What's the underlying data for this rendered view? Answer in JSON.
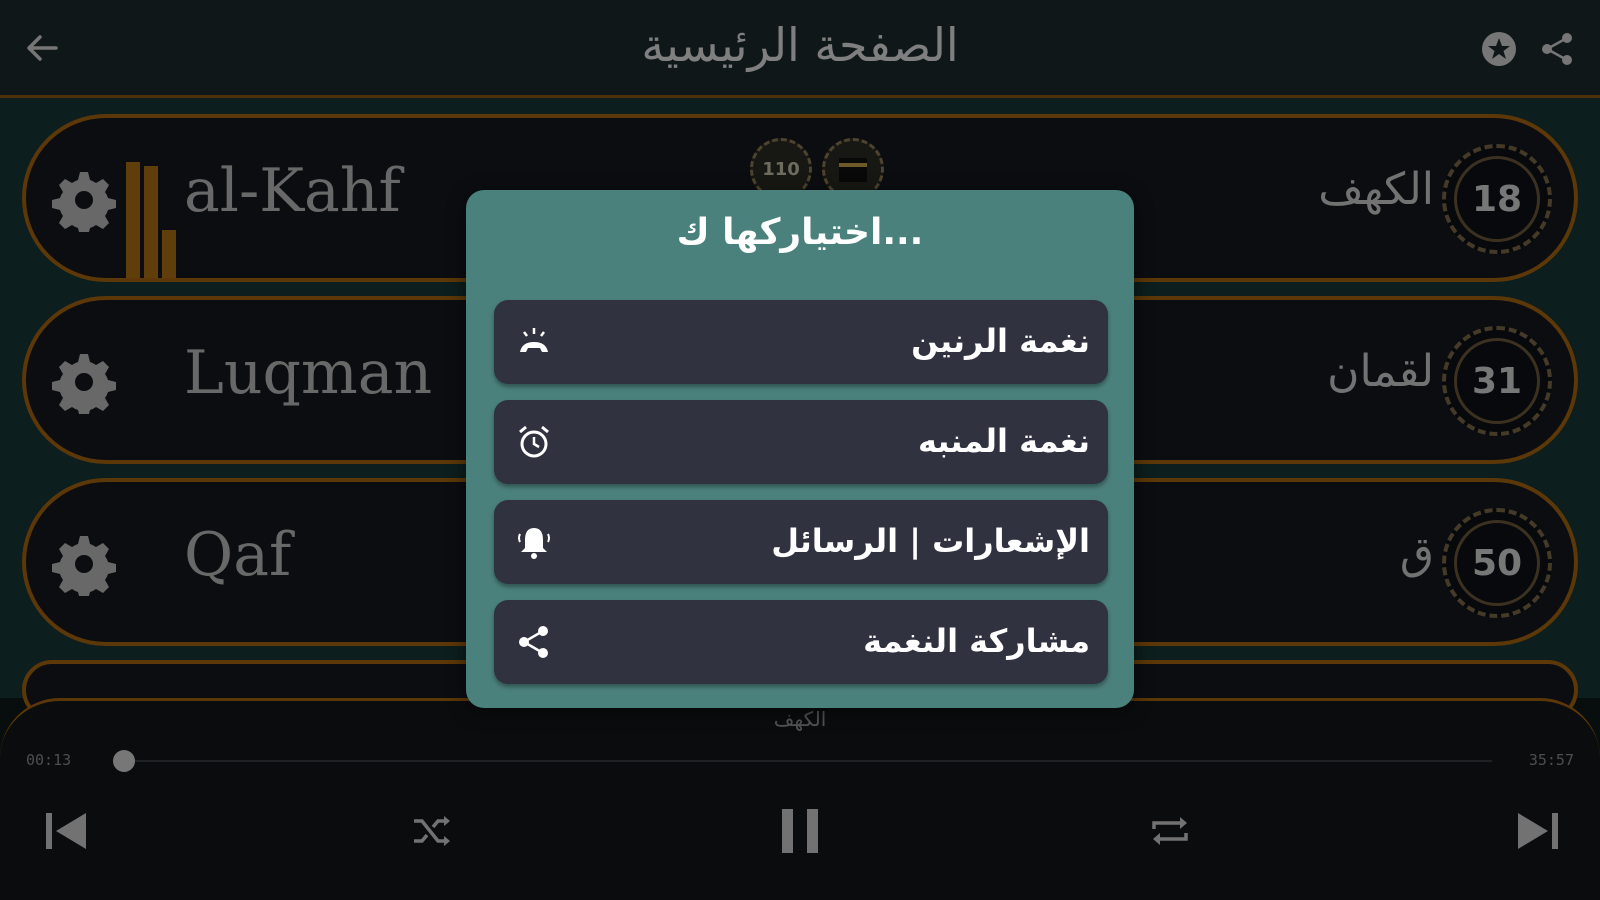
{
  "header": {
    "title": "الصفحة الرئيسية",
    "back_icon": "arrow-left-icon",
    "favorite_icon": "star-circle-icon",
    "share_icon": "share-icon"
  },
  "surahs": [
    {
      "latin": "al-Kahf",
      "arabic": "الكهف",
      "number": "18"
    },
    {
      "latin": "Luqman",
      "arabic": "لقمان",
      "number": "31"
    },
    {
      "latin": "Qaf",
      "arabic": "ق",
      "number": "50"
    }
  ],
  "badges": {
    "verse_count": "110"
  },
  "dialog": {
    "title": "اختياركها ك...",
    "options": [
      {
        "label": "نغمة الرنين",
        "icon": "ringtone-icon"
      },
      {
        "label": "نغمة المنبه",
        "icon": "alarm-icon"
      },
      {
        "label": "الإشعارات | الرسائل",
        "icon": "notification-bell-icon"
      },
      {
        "label": "مشاركة النغمة",
        "icon": "share-icon"
      }
    ]
  },
  "player": {
    "track_title": "الكهف",
    "elapsed": "00:13",
    "total": "35:57",
    "progress": 0.006
  },
  "colors": {
    "accent": "#a8650e",
    "dialog_bg": "#4b817c",
    "option_bg": "#31323f"
  }
}
